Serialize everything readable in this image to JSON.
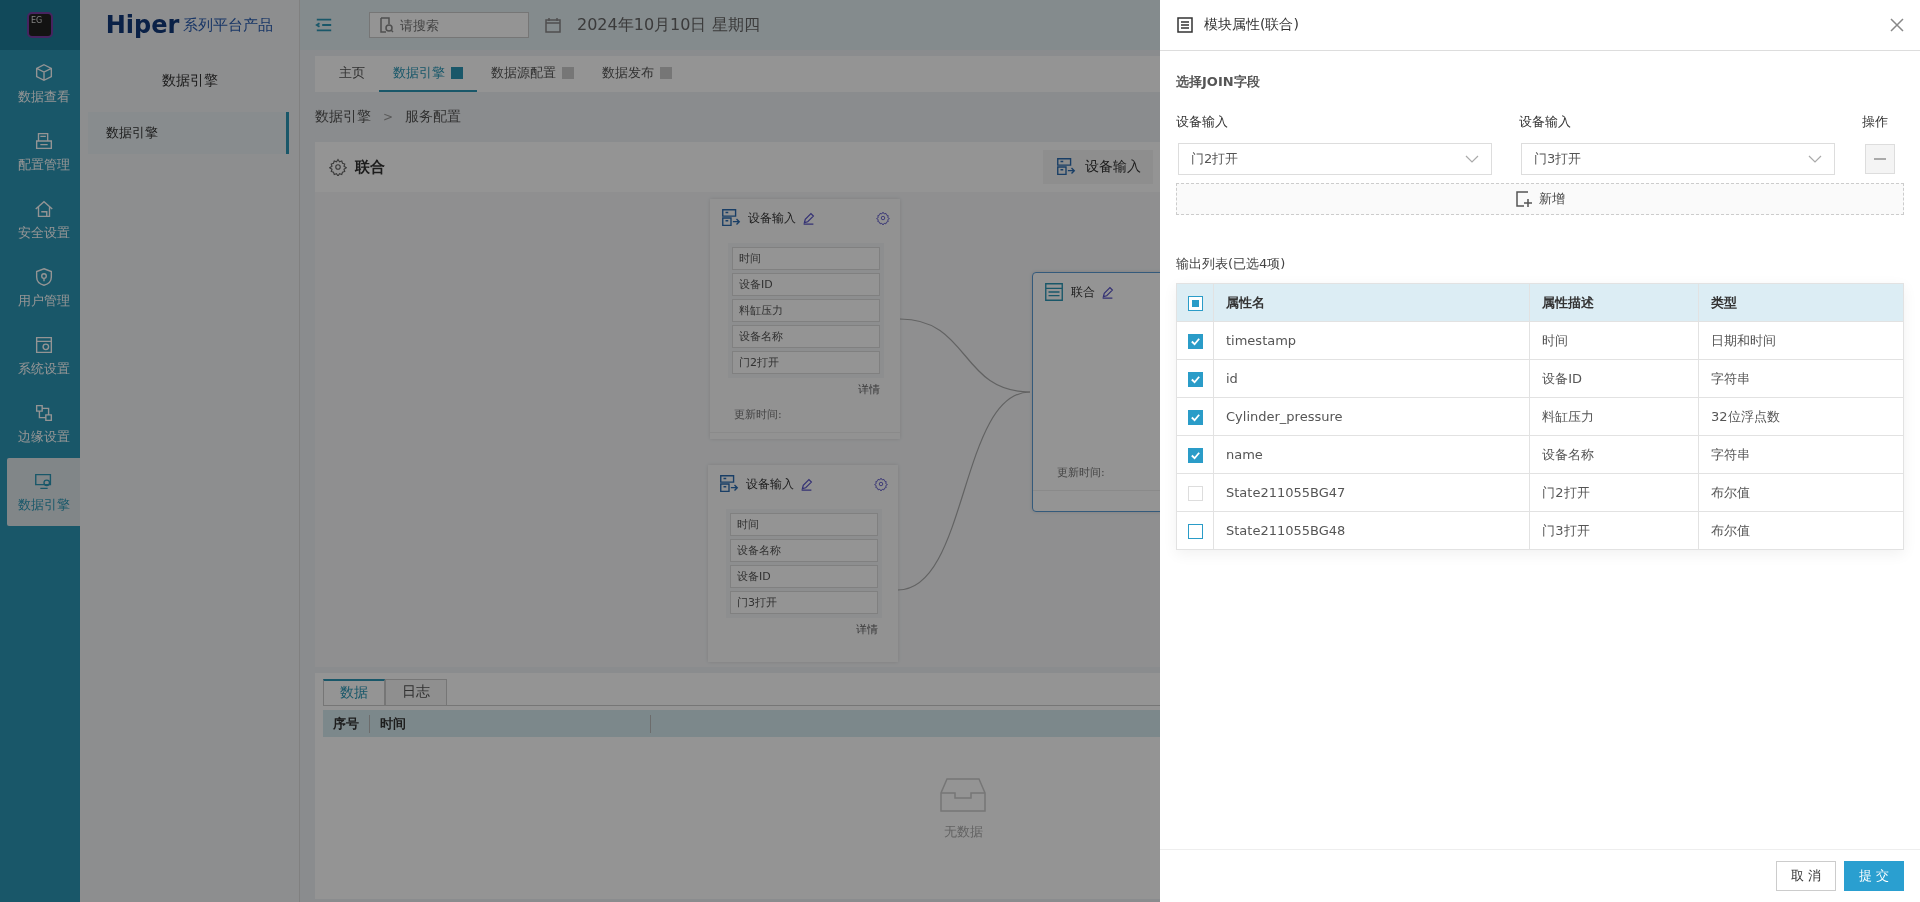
{
  "rail": {
    "logo_text": "EG",
    "items": [
      {
        "label": "数据查看",
        "selected": false
      },
      {
        "label": "配置管理",
        "selected": false
      },
      {
        "label": "安全设置",
        "selected": false
      },
      {
        "label": "用户管理",
        "selected": false
      },
      {
        "label": "系统设置",
        "selected": false
      },
      {
        "label": "边缘设置",
        "selected": false
      },
      {
        "label": "数据引擎",
        "selected": true
      }
    ]
  },
  "brand": {
    "name": "Hiper",
    "tagline": "系列平台产品"
  },
  "sidebar": {
    "title": "数据引擎",
    "items": [
      {
        "label": "数据引擎",
        "selected": true
      }
    ]
  },
  "header": {
    "search_placeholder": "请搜索",
    "date": "2024年10月10日 星期四"
  },
  "tabs": [
    {
      "label": "主页",
      "selected": false,
      "closable": false
    },
    {
      "label": "数据引擎",
      "selected": true,
      "closable": true
    },
    {
      "label": "数据源配置",
      "selected": false,
      "closable": true
    },
    {
      "label": "数据发布",
      "selected": false,
      "closable": true
    }
  ],
  "breadcrumb": {
    "items": [
      "数据引擎",
      "服务配置"
    ],
    "separator": ">"
  },
  "panel": {
    "title": "联合",
    "toolbar_item": "设备输入"
  },
  "canvas": {
    "nodes": [
      {
        "kind": "input",
        "title": "设备输入",
        "fields": [
          "时间",
          "设备ID",
          "料缸压力",
          "设备名称",
          "门2打开"
        ],
        "details": "详情",
        "updated": "更新时间:"
      },
      {
        "kind": "input",
        "title": "设备输入",
        "fields": [
          "时间",
          "设备名称",
          "设备ID",
          "门3打开"
        ],
        "details": "详情"
      },
      {
        "kind": "join",
        "title": "联合",
        "updated": "更新时间:"
      }
    ],
    "edges_shown": true
  },
  "bottom": {
    "tabs": [
      {
        "label": "数据",
        "selected": true
      },
      {
        "label": "日志",
        "selected": false
      }
    ],
    "columns": [
      "序号",
      "时间"
    ],
    "empty": "无数据"
  },
  "drawer": {
    "title": "模块属性(联合)",
    "join": {
      "title": "选择JOIN字段",
      "columns": [
        "设备输入",
        "设备输入",
        "操作"
      ],
      "rows": [
        {
          "left": "门2打开",
          "right": "门3打开"
        }
      ],
      "add_label": "新增"
    },
    "output": {
      "title": "输出列表(已选4项)",
      "select_all_partial": true,
      "columns": [
        "属性名",
        "属性描述",
        "类型"
      ],
      "rows": [
        {
          "name": "timestamp",
          "description": "时间",
          "type": "日期和时间",
          "checked": true,
          "disabled": false
        },
        {
          "name": "id",
          "description": "设备ID",
          "type": "字符串",
          "checked": true,
          "disabled": false
        },
        {
          "name": "Cylinder_pressure",
          "description": "料缸压力",
          "type": "32位浮点数",
          "checked": true,
          "disabled": false
        },
        {
          "name": "name",
          "description": "设备名称",
          "type": "字符串",
          "checked": true,
          "disabled": false
        },
        {
          "name": "State211055BG47",
          "description": "门2打开",
          "type": "布尔值",
          "checked": false,
          "disabled": true
        },
        {
          "name": "State211055BG48",
          "description": "门3打开",
          "type": "布尔值",
          "checked": false,
          "disabled": false
        }
      ]
    },
    "buttons": [
      {
        "label": "取 消",
        "kind": "default"
      },
      {
        "label": "提 交",
        "kind": "primary"
      }
    ]
  }
}
